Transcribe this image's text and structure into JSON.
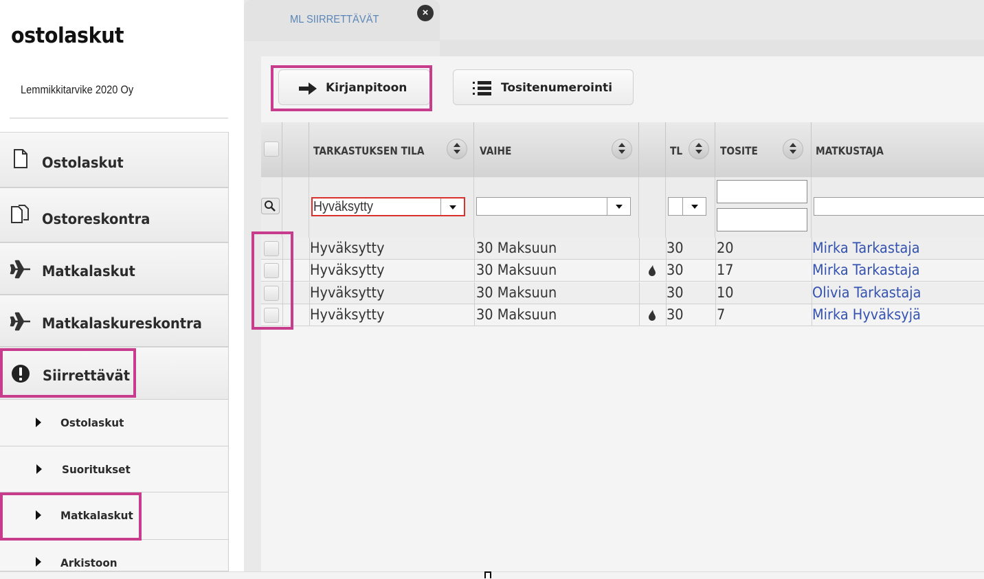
{
  "sidebar": {
    "app_title": "ostolaskut",
    "company": "Lemmikkitarvike 2020 Oy",
    "items": [
      {
        "label": "Ostolaskut",
        "icon": "document-icon"
      },
      {
        "label": "Ostoreskontra",
        "icon": "documents-icon"
      },
      {
        "label": "Matkalaskut",
        "icon": "airplane-icon"
      },
      {
        "label": "Matkalaskureskontra",
        "icon": "airplane-icon"
      },
      {
        "label": "Siirrettävät",
        "icon": "exclamation-icon"
      }
    ],
    "subitems": [
      {
        "label": "Ostolaskut"
      },
      {
        "label": "Suoritukset"
      },
      {
        "label": "Matkalaskut"
      },
      {
        "label": "Arkistoon"
      }
    ]
  },
  "tab": {
    "label": "ML SIIRRETTÄVÄT",
    "close_icon": "close-icon"
  },
  "toolbar": {
    "kirjanpitoon_label": "Kirjanpitoon",
    "tositenumerointi_label": "Tositenumerointi"
  },
  "grid": {
    "columns": [
      {
        "label": "TARKASTUKSEN TILA"
      },
      {
        "label": "VAIHE"
      },
      {
        "label": "TL"
      },
      {
        "label": "TOSITE"
      },
      {
        "label": "MATKUSTAJA"
      }
    ],
    "filter": {
      "tila_value": "Hyväksytty",
      "vaihe_value": "",
      "tl_value": "",
      "tosite_from": "",
      "tosite_to": "",
      "matkustaja_value": ""
    },
    "rows": [
      {
        "tila": "Hyväksytty",
        "vaihe": "30 Maksuun",
        "flag": false,
        "tl": "30",
        "tosite": "20",
        "matkustaja": "Mirka Tarkastaja"
      },
      {
        "tila": "Hyväksytty",
        "vaihe": "30 Maksuun",
        "flag": true,
        "tl": "30",
        "tosite": "17",
        "matkustaja": "Mirka Tarkastaja"
      },
      {
        "tila": "Hyväksytty",
        "vaihe": "30 Maksuun",
        "flag": false,
        "tl": "30",
        "tosite": "10",
        "matkustaja": "Olivia Tarkastaja"
      },
      {
        "tila": "Hyväksytty",
        "vaihe": "30 Maksuun",
        "flag": true,
        "tl": "30",
        "tosite": "7",
        "matkustaja": "Mirka Hyväksyjä"
      }
    ]
  },
  "colors": {
    "highlight": "#c83c8e",
    "link": "#3452b0",
    "tab_text": "#5a86b8"
  }
}
